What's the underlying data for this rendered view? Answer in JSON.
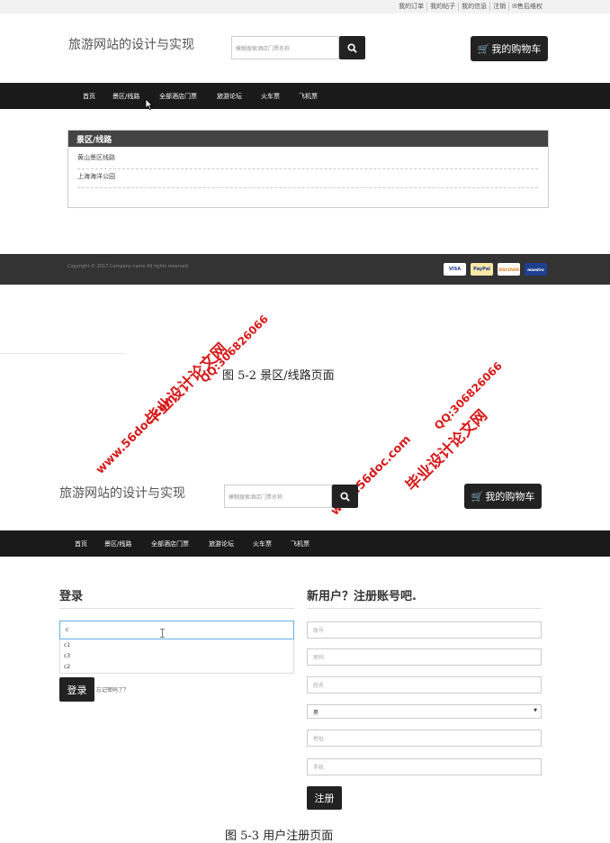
{
  "top_links": [
    "我的订单",
    "我的帖子",
    "我的信息",
    "注销",
    "✉售后维权"
  ],
  "site_title": "旅游网站的设计与实现",
  "search_placeholder": "模糊搜索酒店门票名称",
  "cart_label": "我的购物车",
  "nav_items": [
    "首页",
    "景区/线路",
    "全部酒店门票",
    "旅游论坛",
    "火车票",
    "飞机票"
  ],
  "panel": {
    "title": "景区/线路",
    "rows": [
      "黄山景区线路",
      "上海海洋公园"
    ]
  },
  "footer": {
    "copyright": "Copyright © 2017.Company name All rights reserved.",
    "payments": [
      "VISA",
      "PayPal",
      "DISCOVER",
      "maestro"
    ]
  },
  "caption1": "图 5-2 景区/线路页面",
  "caption2": "图 5-3 用户注册页面",
  "watermark": {
    "name": "毕业设计论文网",
    "qq": "QQ:306826066",
    "url": "www.56doc.com"
  },
  "login": {
    "title": "登录",
    "input_value": "c",
    "suggestions": [
      "c1",
      "c3",
      "c2"
    ],
    "button": "登录",
    "forgot": "忘记密码了？"
  },
  "register": {
    "title": "新用户？注册账号吧.",
    "fields": [
      "账号",
      "密码",
      "姓名"
    ],
    "gender_value": "男",
    "fields2": [
      "地址",
      "手机"
    ],
    "button": "注册"
  },
  "colors": {
    "dark": "#1a1a1a",
    "footer": "#333333",
    "watermark": "#d61b1b"
  }
}
